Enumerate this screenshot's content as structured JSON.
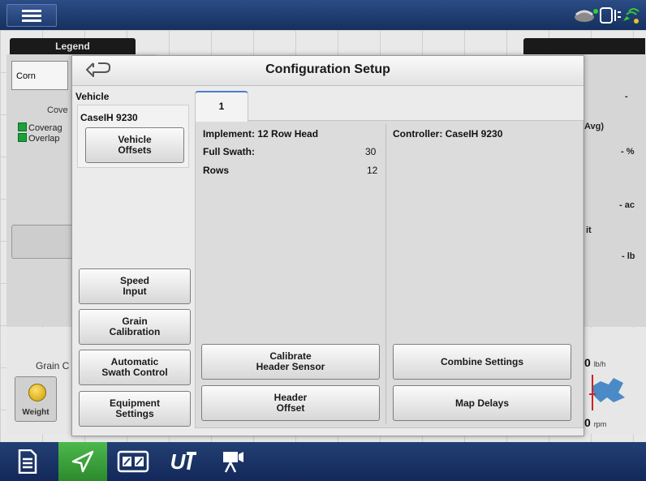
{
  "topbar": {
    "menu_icon": "hamburger-icon",
    "status_icons": [
      "gps-antenna-icon",
      "implement-status-icon",
      "satellite-signal-icon"
    ]
  },
  "background": {
    "legend_tab": "Legend",
    "crop": "Corn",
    "coverage_title": "Cove",
    "coverage_lines": [
      "Coverag",
      "Overlap"
    ],
    "grain_label": "Grain C",
    "weight_button": "Weight",
    "right_values": [
      "-",
      "Avg)",
      "- %",
      "- ac",
      "it",
      "- lb"
    ],
    "flow_value": "0",
    "flow_unit": "lb/h",
    "rpm_value": "0",
    "rpm_unit": "rpm"
  },
  "dialog": {
    "title": "Configuration Setup",
    "back_icon": "back-arrow-icon",
    "vehicle_label": "Vehicle",
    "vehicle_name": "CaseIH 9230",
    "buttons": {
      "vehicle_offsets": "Vehicle\nOffsets",
      "speed_input": "Speed\nInput",
      "grain_calibration": "Grain\nCalibration",
      "automatic_swath_control": "Automatic\nSwath Control",
      "equipment_settings": "Equipment\nSettings",
      "calibrate_header_sensor": "Calibrate\nHeader Sensor",
      "header_offset": "Header\nOffset",
      "combine_settings": "Combine Settings",
      "map_delays": "Map Delays"
    },
    "tab_label": "1",
    "implement": "Implement: 12 Row Head",
    "full_swath_label": "Full Swath:",
    "full_swath_value": "30",
    "rows_label": "Rows",
    "rows_value": "12",
    "controller": "Controller: CaseIH 9230"
  },
  "bottombar": {
    "items": [
      {
        "icon": "document-icon",
        "active": false
      },
      {
        "icon": "map-navigation-icon",
        "active": true
      },
      {
        "icon": "split-screen-icon",
        "active": false
      },
      {
        "icon": "ut-virtual-terminal-icon",
        "label": "U",
        "active": false
      },
      {
        "icon": "video-camera-icon",
        "active": false
      }
    ]
  }
}
